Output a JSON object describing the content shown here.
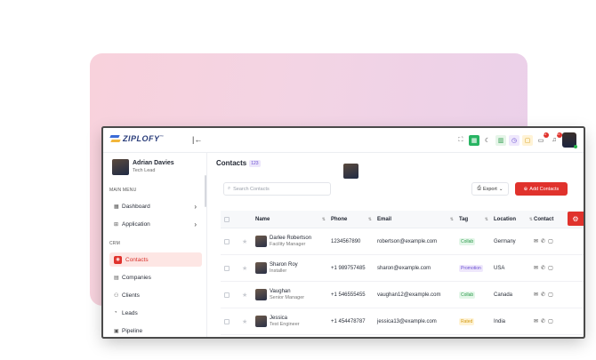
{
  "app": {
    "logo_text": "ZIPLOFY",
    "logo_sup": "™",
    "collapse_glyph": "|←"
  },
  "topbar_icons": [
    {
      "icon": "expand-icon",
      "glyph": "⛶",
      "bg": "transparent",
      "fg": "#444"
    },
    {
      "icon": "grid-icon",
      "glyph": "▦",
      "bg": "#28b463",
      "fg": "#fff"
    },
    {
      "icon": "moon-icon",
      "glyph": "☾",
      "bg": "transparent",
      "fg": "#333"
    },
    {
      "icon": "chart-icon",
      "glyph": "▥",
      "bg": "#e6f5e9",
      "fg": "#2d9a4c"
    },
    {
      "icon": "clock-icon",
      "glyph": "◷",
      "bg": "#efe8fc",
      "fg": "#6a4fd1"
    },
    {
      "icon": "note-icon",
      "glyph": "▢",
      "bg": "#fff3d6",
      "fg": "#d39a10"
    },
    {
      "icon": "chat-icon",
      "glyph": "▭",
      "bg": "transparent",
      "fg": "#444",
      "badge": "14"
    },
    {
      "icon": "bell-icon",
      "glyph": "♫",
      "bg": "transparent",
      "fg": "#444",
      "badge": "10"
    }
  ],
  "user": {
    "name": "Adrian Davies",
    "role": "Tech Lead"
  },
  "sidebar": {
    "section_main": "MAIN MENU",
    "section_crm": "CRM",
    "main_items": [
      {
        "label": "Dashboard",
        "icon": "dashboard-icon",
        "glyph": "▦",
        "chevron": "›"
      },
      {
        "label": "Application",
        "icon": "application-icon",
        "glyph": "⊞",
        "chevron": "›"
      }
    ],
    "crm_items": [
      {
        "label": "Contacts",
        "icon": "contacts-icon",
        "glyph": "◉",
        "active": true
      },
      {
        "label": "Companies",
        "icon": "companies-icon",
        "glyph": "▤"
      },
      {
        "label": "Clients",
        "icon": "clients-icon",
        "glyph": "⚇"
      },
      {
        "label": "Leads",
        "icon": "leads-icon",
        "glyph": "◔"
      },
      {
        "label": "Pipeline",
        "icon": "pipeline-icon",
        "glyph": "▣"
      }
    ]
  },
  "page": {
    "title": "Contacts",
    "count": "123",
    "search_placeholder": "Search Contacts",
    "export_label": "Export",
    "add_label": "Add Contacts"
  },
  "table": {
    "columns": [
      "Name",
      "Phone",
      "Email",
      "Tag",
      "Location",
      "Contact"
    ],
    "rows": [
      {
        "name": "Darlee Robertson",
        "role": "Facility Manager",
        "phone": "1234567890",
        "email": "robertson@example.com",
        "tag": "Collab",
        "tag_type": "collab",
        "location": "Germany"
      },
      {
        "name": "Sharon Roy",
        "role": "Installer",
        "phone": "+1 989757485",
        "email": "sharon@example.com",
        "tag": "Promotion",
        "tag_type": "promotion",
        "location": "USA"
      },
      {
        "name": "Vaughan",
        "role": "Senior Manager",
        "phone": "+1 546555455",
        "email": "vaughan12@example.com",
        "tag": "Collab",
        "tag_type": "collab",
        "location": "Canada"
      },
      {
        "name": "Jessica",
        "role": "Test Engineer",
        "phone": "+1 454478787",
        "email": "jessica13@example.com",
        "tag": "Rated",
        "tag_type": "rated",
        "location": "India"
      }
    ]
  },
  "colors": {
    "accent": "#e0322c",
    "pink_panel": "#f5d3e0"
  }
}
